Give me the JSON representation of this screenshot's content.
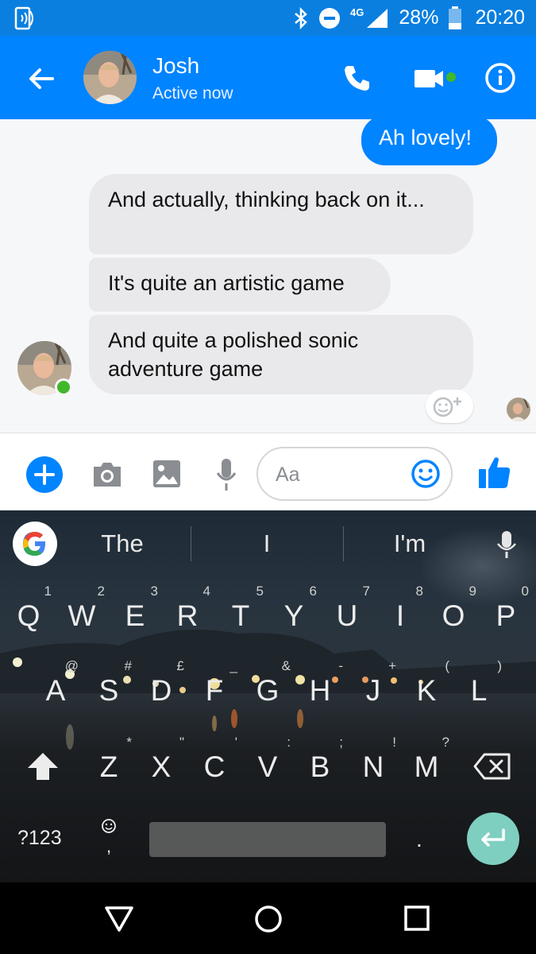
{
  "status_bar": {
    "network_label": "4G",
    "battery_percent": "28%",
    "time": "20:20"
  },
  "header": {
    "contact_name": "Josh",
    "contact_status": "Active now"
  },
  "chat": {
    "messages": [
      {
        "direction": "outgoing",
        "text": "Ah lovely!"
      },
      {
        "direction": "incoming",
        "text": "And actually, thinking back on it..."
      },
      {
        "direction": "incoming",
        "text": "It's quite an artistic game"
      },
      {
        "direction": "incoming",
        "text": "And quite a polished sonic adventure game"
      }
    ]
  },
  "composer": {
    "placeholder": "Aa"
  },
  "keyboard": {
    "suggestions": [
      "The",
      "I",
      "I'm"
    ],
    "row1": [
      {
        "label": "Q",
        "hint": "1"
      },
      {
        "label": "W",
        "hint": "2"
      },
      {
        "label": "E",
        "hint": "3"
      },
      {
        "label": "R",
        "hint": "4"
      },
      {
        "label": "T",
        "hint": "5"
      },
      {
        "label": "Y",
        "hint": "6"
      },
      {
        "label": "U",
        "hint": "7"
      },
      {
        "label": "I",
        "hint": "8"
      },
      {
        "label": "O",
        "hint": "9"
      },
      {
        "label": "P",
        "hint": "0"
      }
    ],
    "row2": [
      {
        "label": "A",
        "hint": "@"
      },
      {
        "label": "S",
        "hint": "#"
      },
      {
        "label": "D",
        "hint": "£"
      },
      {
        "label": "F",
        "hint": "_"
      },
      {
        "label": "G",
        "hint": "&"
      },
      {
        "label": "H",
        "hint": "-"
      },
      {
        "label": "J",
        "hint": "+"
      },
      {
        "label": "K",
        "hint": "("
      },
      {
        "label": "L",
        "hint": ")"
      }
    ],
    "row3": [
      {
        "label": "Z",
        "hint": "*"
      },
      {
        "label": "X",
        "hint": "\""
      },
      {
        "label": "C",
        "hint": "'"
      },
      {
        "label": "V",
        "hint": ":"
      },
      {
        "label": "B",
        "hint": ";"
      },
      {
        "label": "N",
        "hint": "!"
      },
      {
        "label": "M",
        "hint": "?"
      }
    ],
    "symbols_label": "?123",
    "period_label": ".",
    "comma_label": ","
  },
  "colors": {
    "status_bar": "#0a7fe0",
    "brand_blue": "#0084ff",
    "incoming_bubble": "#e9e9eb",
    "online_green": "#42b72a",
    "enter_key": "#7fcfc1"
  },
  "icons": [
    "nfc-icon",
    "bluetooth-icon",
    "dnd-icon",
    "signal-icon",
    "battery-icon",
    "back-arrow-icon",
    "phone-icon",
    "video-camera-icon",
    "info-icon",
    "add-reaction-icon",
    "plus-icon",
    "camera-icon",
    "gallery-icon",
    "microphone-icon",
    "emoji-icon",
    "thumbs-up-icon",
    "google-icon",
    "shift-icon",
    "backspace-icon",
    "enter-icon",
    "nav-back-icon",
    "nav-home-icon",
    "nav-recents-icon"
  ]
}
